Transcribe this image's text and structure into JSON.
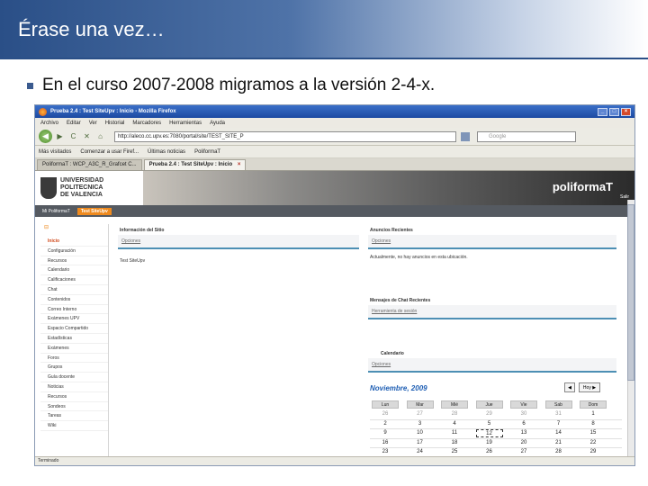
{
  "slide": {
    "title": "Érase una vez…",
    "bullet": "En el curso 2007-2008 migramos a la versión 2-4-x."
  },
  "browser": {
    "window_title": "Prueba 2.4 : Test SiteUpv : Inicio - Mozilla Firefox",
    "window_buttons": [
      "_",
      "□",
      "×"
    ],
    "menu": [
      "Archivo",
      "Editar",
      "Ver",
      "Historial",
      "Marcadores",
      "Herramientas",
      "Ayuda"
    ],
    "nav_back": "◀",
    "nav_forward": "▶",
    "nav_reload": "C",
    "nav_stop": "✕",
    "nav_home": "⌂",
    "url": "http://aleco.cc.upv.es:7080/portal/site/TEST_SITE_P",
    "search_placeholder": "Google",
    "bookmarks": [
      "Más visitados",
      "Comenzar a usar Firef...",
      "Últimas noticias",
      "PoliformaT"
    ],
    "tabs": [
      {
        "label": "PoliformaT : WCP_A3C_R_Grafcet C...",
        "close": "×"
      },
      {
        "label": "Prueba 2.4 : Test SiteUpv : Inicio",
        "close": "×"
      }
    ],
    "status": "Terminado"
  },
  "site": {
    "logo_text": [
      "UNIVERSIDAD",
      "POLITECNICA",
      "DE VALENCIA"
    ],
    "brand": "poliformaT",
    "salir": "Salir",
    "tabs": [
      "Mi PoliformaT",
      "Test SiteUpv"
    ],
    "nav_top_icon": "⊟",
    "nav": [
      "Inicio",
      "Configuración",
      "Recursos",
      "Calendario",
      "Calificaciones",
      "Chat",
      "Contenidos",
      "Correo Interno",
      "Exámenes UPV",
      "Espacio Compartido",
      "Estadísticas",
      "Exámenes",
      "Foros",
      "Grupos",
      "Guía docente",
      "Noticias",
      "Recursos",
      "Sondeos",
      "Tareas",
      "Wiki"
    ],
    "info_title": "Información del Sitio",
    "info_options": "Opciones",
    "info_text": "Test SiteUpv",
    "ann_title": "Anuncios Recientes",
    "ann_options": "Opciones",
    "ann_text": "Actualmente, no hay anuncios en esta ubicación.",
    "chat_title": "Mensajes de Chat Recientes",
    "chat_options": "Herramienta de sesión",
    "cal_title": "Calendario",
    "cal_options": "Opciones",
    "calendar": {
      "month": "Noviembre, 2009",
      "prev": "◀",
      "next": "Hoy ▶",
      "headers": [
        "Lun",
        "Mar",
        "Mié",
        "Jue",
        "Vie",
        "Sab",
        "Dom"
      ],
      "rows": [
        [
          "26",
          "27",
          "28",
          "29",
          "30",
          "31",
          "1"
        ],
        [
          "2",
          "3",
          "4",
          "5",
          "6",
          "7",
          "8"
        ],
        [
          "9",
          "10",
          "11",
          "12",
          "13",
          "14",
          "15"
        ],
        [
          "16",
          "17",
          "18",
          "19",
          "20",
          "21",
          "22"
        ],
        [
          "23",
          "24",
          "25",
          "26",
          "27",
          "28",
          "29"
        ]
      ]
    }
  }
}
